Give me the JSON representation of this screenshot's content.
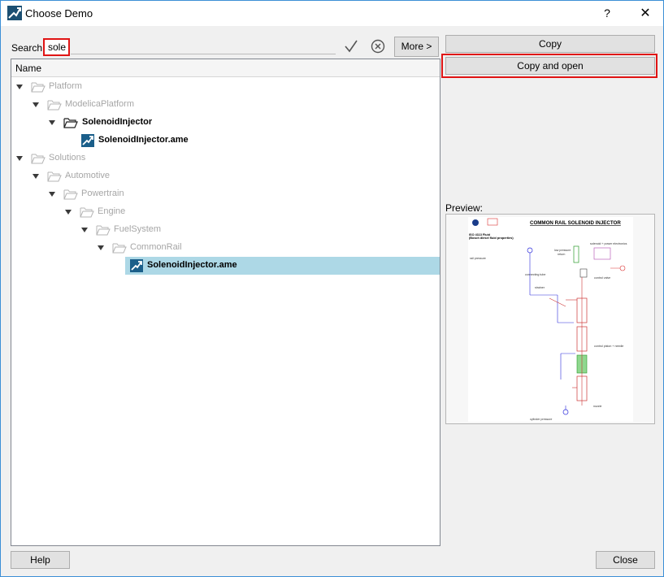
{
  "window": {
    "title": "Choose Demo",
    "help_symbol": "?",
    "close_symbol": "✕",
    "icon": "amesim-logo-icon"
  },
  "search": {
    "label": "Search:",
    "value": "sole",
    "more_label": "More >"
  },
  "actions": {
    "copy_label": "Copy",
    "copy_open_label": "Copy and open"
  },
  "tree": {
    "header": "Name",
    "items": [
      {
        "label": "Platform",
        "icon": "folder-open-icon"
      },
      {
        "label": "ModelicaPlatform",
        "icon": "folder-open-icon"
      },
      {
        "label": "SolenoidInjector",
        "icon": "folder-open-icon"
      },
      {
        "label": "SolenoidInjector.ame",
        "icon": "amesim-file-icon"
      },
      {
        "label": "Solutions",
        "icon": "folder-open-icon"
      },
      {
        "label": "Automotive",
        "icon": "folder-open-icon"
      },
      {
        "label": "Powertrain",
        "icon": "folder-open-icon"
      },
      {
        "label": "Engine",
        "icon": "folder-open-icon"
      },
      {
        "label": "FuelSystem",
        "icon": "folder-open-icon"
      },
      {
        "label": "CommonRail",
        "icon": "folder-open-icon"
      },
      {
        "label": "SolenoidInjector.ame",
        "icon": "amesim-file-icon",
        "selected": true
      }
    ]
  },
  "preview": {
    "label": "Preview:",
    "diagram_title": "COMMON RAIL SOLENOID INJECTOR",
    "fluid_line1": "ISO 4113 Fluid",
    "fluid_line2": "(Bosch diesel fluid properties)",
    "annotations": {
      "solenoid": "solenoid + power electronics",
      "low_pressure": "low pressure",
      "return": "return",
      "rail_pressure": "rail pressure",
      "control_valve": "control valve",
      "connecting_tube": "connecting tube",
      "strainer": "strainer",
      "control_piston": "control piston + needle",
      "nozzle": "nozzle",
      "cylinder_pressure": "cylinder pressure"
    }
  },
  "footer": {
    "help_label": "Help",
    "close_label": "Close"
  },
  "colors": {
    "accent_border": "#3c8fd6",
    "highlight_red": "#e01414",
    "selection": "#add8e6"
  }
}
